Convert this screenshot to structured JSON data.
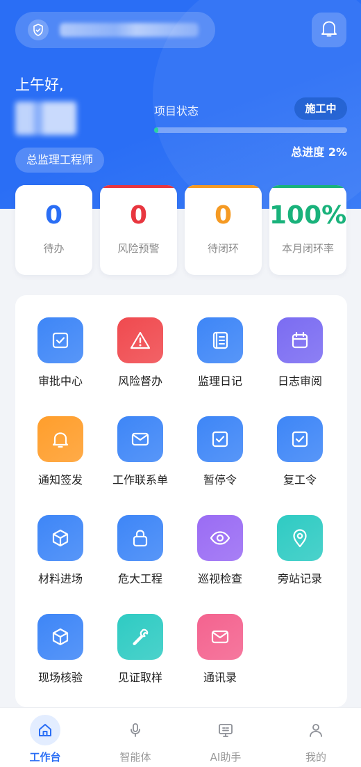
{
  "header": {
    "greeting": "上午好,",
    "role": "总监理工程师",
    "status_label": "项目状态",
    "status_badge": "施工中",
    "progress_text": "总进度 2%",
    "progress_value": 0.02
  },
  "stats": [
    {
      "value": "0",
      "label": "待办",
      "color": "#2a6ef5",
      "bar": "#ffffff"
    },
    {
      "value": "0",
      "label": "风险预警",
      "color": "#e8363f",
      "bar": "#e8363f"
    },
    {
      "value": "0",
      "label": "待闭环",
      "color": "#f59a23",
      "bar": "#f59a23"
    },
    {
      "value": "100%",
      "label": "本月闭环率",
      "color": "#19b27b",
      "bar": "#19b27b"
    }
  ],
  "features": [
    {
      "label": "审批中心",
      "icon": "check-square-icon",
      "color": "#3e86f7"
    },
    {
      "label": "风险督办",
      "icon": "warning-icon",
      "color": "#f04a4f"
    },
    {
      "label": "监理日记",
      "icon": "notebook-icon",
      "color": "#3e86f7"
    },
    {
      "label": "日志审阅",
      "icon": "calendar-icon",
      "color": "#7b6cf2"
    },
    {
      "label": "通知签发",
      "icon": "bell-icon",
      "color": "#ff9e2c"
    },
    {
      "label": "工作联系单",
      "icon": "mail-icon",
      "color": "#3e86f7"
    },
    {
      "label": "暂停令",
      "icon": "check-square-icon",
      "color": "#3e86f7"
    },
    {
      "label": "复工令",
      "icon": "check-square-icon",
      "color": "#3e86f7"
    },
    {
      "label": "材料进场",
      "icon": "box-icon",
      "color": "#3e86f7"
    },
    {
      "label": "危大工程",
      "icon": "lock-icon",
      "color": "#3e86f7"
    },
    {
      "label": "巡视检查",
      "icon": "eye-icon",
      "color": "#9a6cf4"
    },
    {
      "label": "旁站记录",
      "icon": "location-pin-icon",
      "color": "#2fcbc3"
    },
    {
      "label": "现场核验",
      "icon": "box-icon",
      "color": "#3e86f7"
    },
    {
      "label": "见证取样",
      "icon": "wrench-icon",
      "color": "#2fcbc3"
    },
    {
      "label": "通讯录",
      "icon": "mail-icon",
      "color": "#f4638f"
    }
  ],
  "tabs": [
    {
      "label": "工作台",
      "icon": "home-icon",
      "active": true
    },
    {
      "label": "智能体",
      "icon": "microphone-icon",
      "active": false
    },
    {
      "label": "AI助手",
      "icon": "monitor-icon",
      "active": false
    },
    {
      "label": "我的",
      "icon": "user-icon",
      "active": false
    }
  ]
}
